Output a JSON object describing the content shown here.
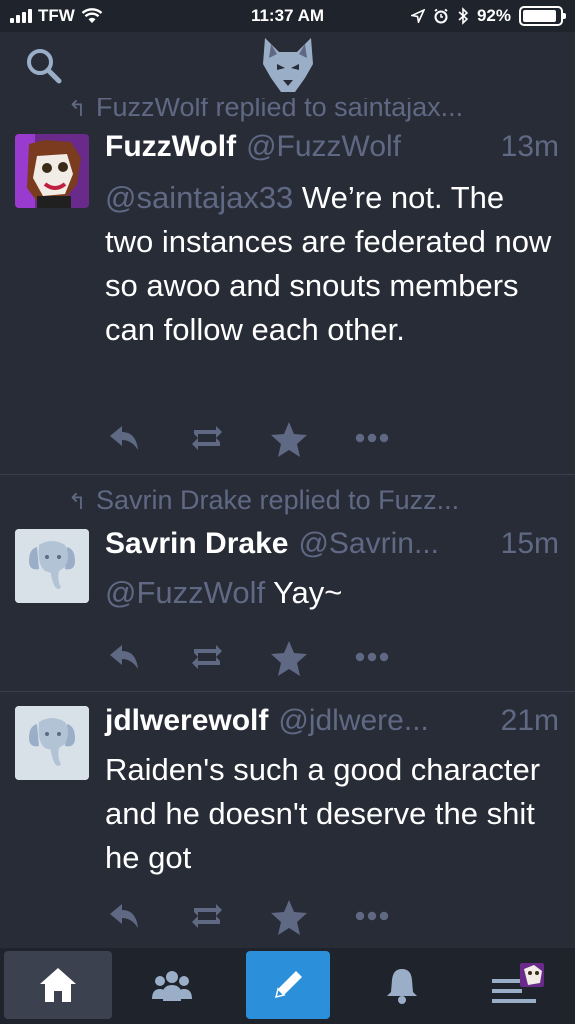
{
  "status_bar": {
    "carrier": "TFW",
    "time": "11:37 AM",
    "battery": "92%",
    "battery_level": 0.92
  },
  "header": {
    "search_icon": "search-icon",
    "logo_icon": "wolf-logo-icon"
  },
  "timeline": [
    {
      "reply_text": "FuzzWolf replied to saintajax...",
      "display_name": "FuzzWolf",
      "handle": "@FuzzWolf",
      "time": "13m",
      "mention": "@saintajax33",
      "text": " We’re not. The two instances are federated now so awoo and snouts members can follow each other.",
      "avatar": "fuzzwolf-avatar"
    },
    {
      "reply_text": "Savrin Drake replied to Fuzz...",
      "display_name": "Savrin Drake",
      "handle": "@Savrin...",
      "time": "15m",
      "mention": "@FuzzWolf",
      "text": " Yay~",
      "avatar": "default-elephant-avatar"
    },
    {
      "display_name": "jdlwerewolf",
      "handle": "@jdlwere...",
      "time": "21m",
      "text": "Raiden's such a good character and he doesn't deserve the shit he got",
      "avatar": "default-elephant-avatar"
    }
  ],
  "tabbar": {
    "items": [
      "home-icon",
      "people-icon",
      "compose-icon",
      "bell-icon",
      "menu-icon"
    ],
    "active": "home"
  },
  "colors": {
    "background": "#282c37",
    "bar": "#1f232b",
    "muted": "#606984",
    "accent": "#2b90d9"
  }
}
